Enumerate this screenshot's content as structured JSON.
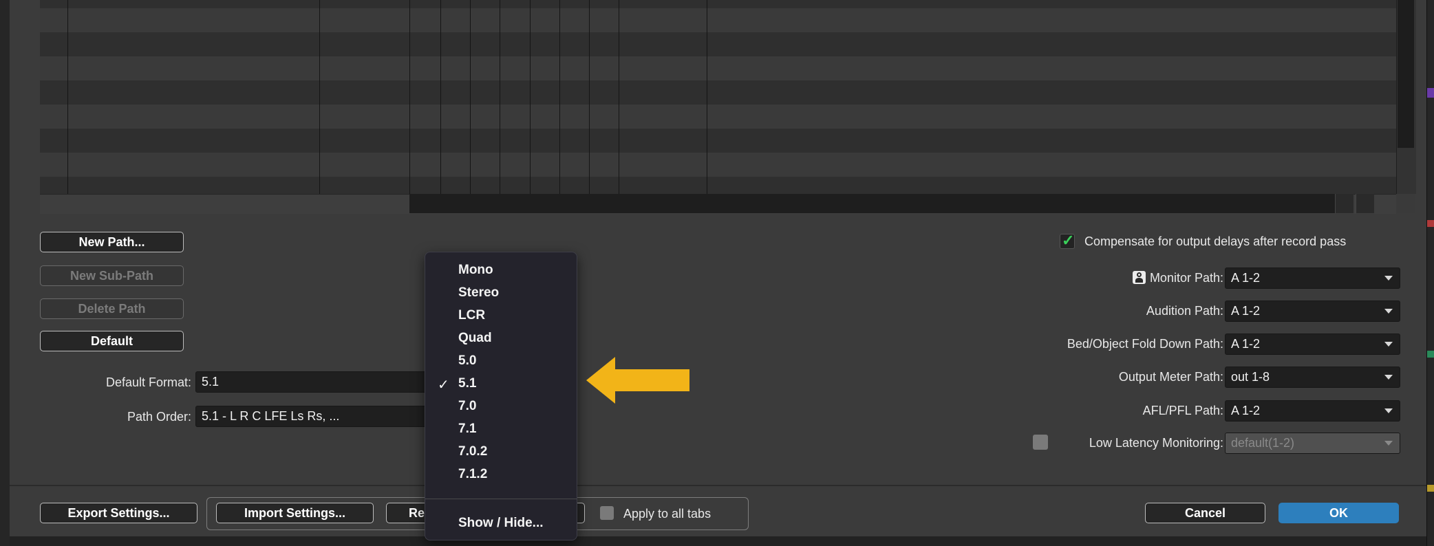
{
  "buttons": {
    "new_path": "New Path...",
    "new_sub_path": "New Sub-Path",
    "delete_path": "Delete Path",
    "default": "Default",
    "export_settings": "Export Settings...",
    "import_settings": "Import Settings...",
    "restore_partial": "Re",
    "cancel": "Cancel",
    "ok": "OK"
  },
  "format": {
    "default_format_label": "Default Format:",
    "default_format_value": "5.1",
    "path_order_label": "Path Order:",
    "path_order_value": "5.1 - L R C LFE Ls Rs, ..."
  },
  "format_menu": {
    "items": [
      "Mono",
      "Stereo",
      "LCR",
      "Quad",
      "5.0",
      "5.1",
      "7.0",
      "7.1",
      "7.0.2",
      "7.1.2"
    ],
    "selected": "5.1",
    "check_glyph": "✓",
    "show_hide": "Show / Hide..."
  },
  "apply_all_tabs": "Apply to all tabs",
  "right_panel": {
    "compensate_label": "Compensate for output delays after record pass",
    "compensate_checked": true,
    "monitor_path_label": "Monitor Path:",
    "monitor_path_value": "A 1-2",
    "audition_path_label": "Audition Path:",
    "audition_path_value": "A 1-2",
    "bed_object_label": "Bed/Object Fold Down Path:",
    "bed_object_value": "A 1-2",
    "output_meter_label": "Output Meter Path:",
    "output_meter_value": "out 1-8",
    "afl_pfl_label": "AFL/PFL Path:",
    "afl_pfl_value": "A 1-2",
    "low_latency_label": "Low Latency Monitoring:",
    "low_latency_value": "default(1-2)",
    "low_latency_checked": false
  },
  "icons": {
    "monitor": "speaker-icon",
    "arrow": "yellow-left-arrow",
    "arrow_color": "#f2b418",
    "ok_color": "#2d7fbd",
    "check_color": "#3ad15a"
  }
}
